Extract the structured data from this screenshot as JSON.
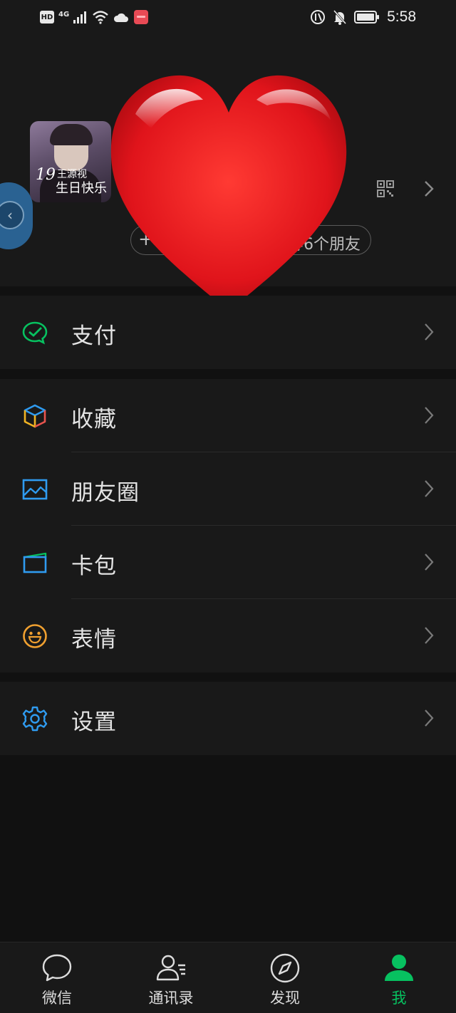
{
  "status_bar": {
    "left_badges": [
      "HD",
      "4G"
    ],
    "time": "5:58"
  },
  "profile": {
    "avatar_caption_number": "19",
    "avatar_caption_line1": "王源视",
    "avatar_caption_line2": "生日快乐",
    "status_pill_plus": "+",
    "status_pill_text": "等6个朋友"
  },
  "menu": {
    "pay": {
      "label": "支付",
      "icon": "wechat-pay-icon"
    },
    "favorites": {
      "label": "收藏",
      "icon": "cube-icon"
    },
    "moments": {
      "label": "朋友圈",
      "icon": "image-icon"
    },
    "cards": {
      "label": "卡包",
      "icon": "wallet-card-icon"
    },
    "stickers": {
      "label": "表情",
      "icon": "smiley-icon"
    },
    "settings": {
      "label": "设置",
      "icon": "gear-icon"
    }
  },
  "bottom_nav": {
    "items": [
      {
        "label": "微信",
        "icon": "chat-bubble-icon",
        "active": false
      },
      {
        "label": "通讯录",
        "icon": "contacts-icon",
        "active": false
      },
      {
        "label": "发现",
        "icon": "compass-icon",
        "active": false
      },
      {
        "label": "我",
        "icon": "person-icon",
        "active": true
      }
    ]
  },
  "colors": {
    "accent": "#07c160",
    "background": "#111111",
    "surface": "#191919",
    "heart": "#e0141b"
  }
}
